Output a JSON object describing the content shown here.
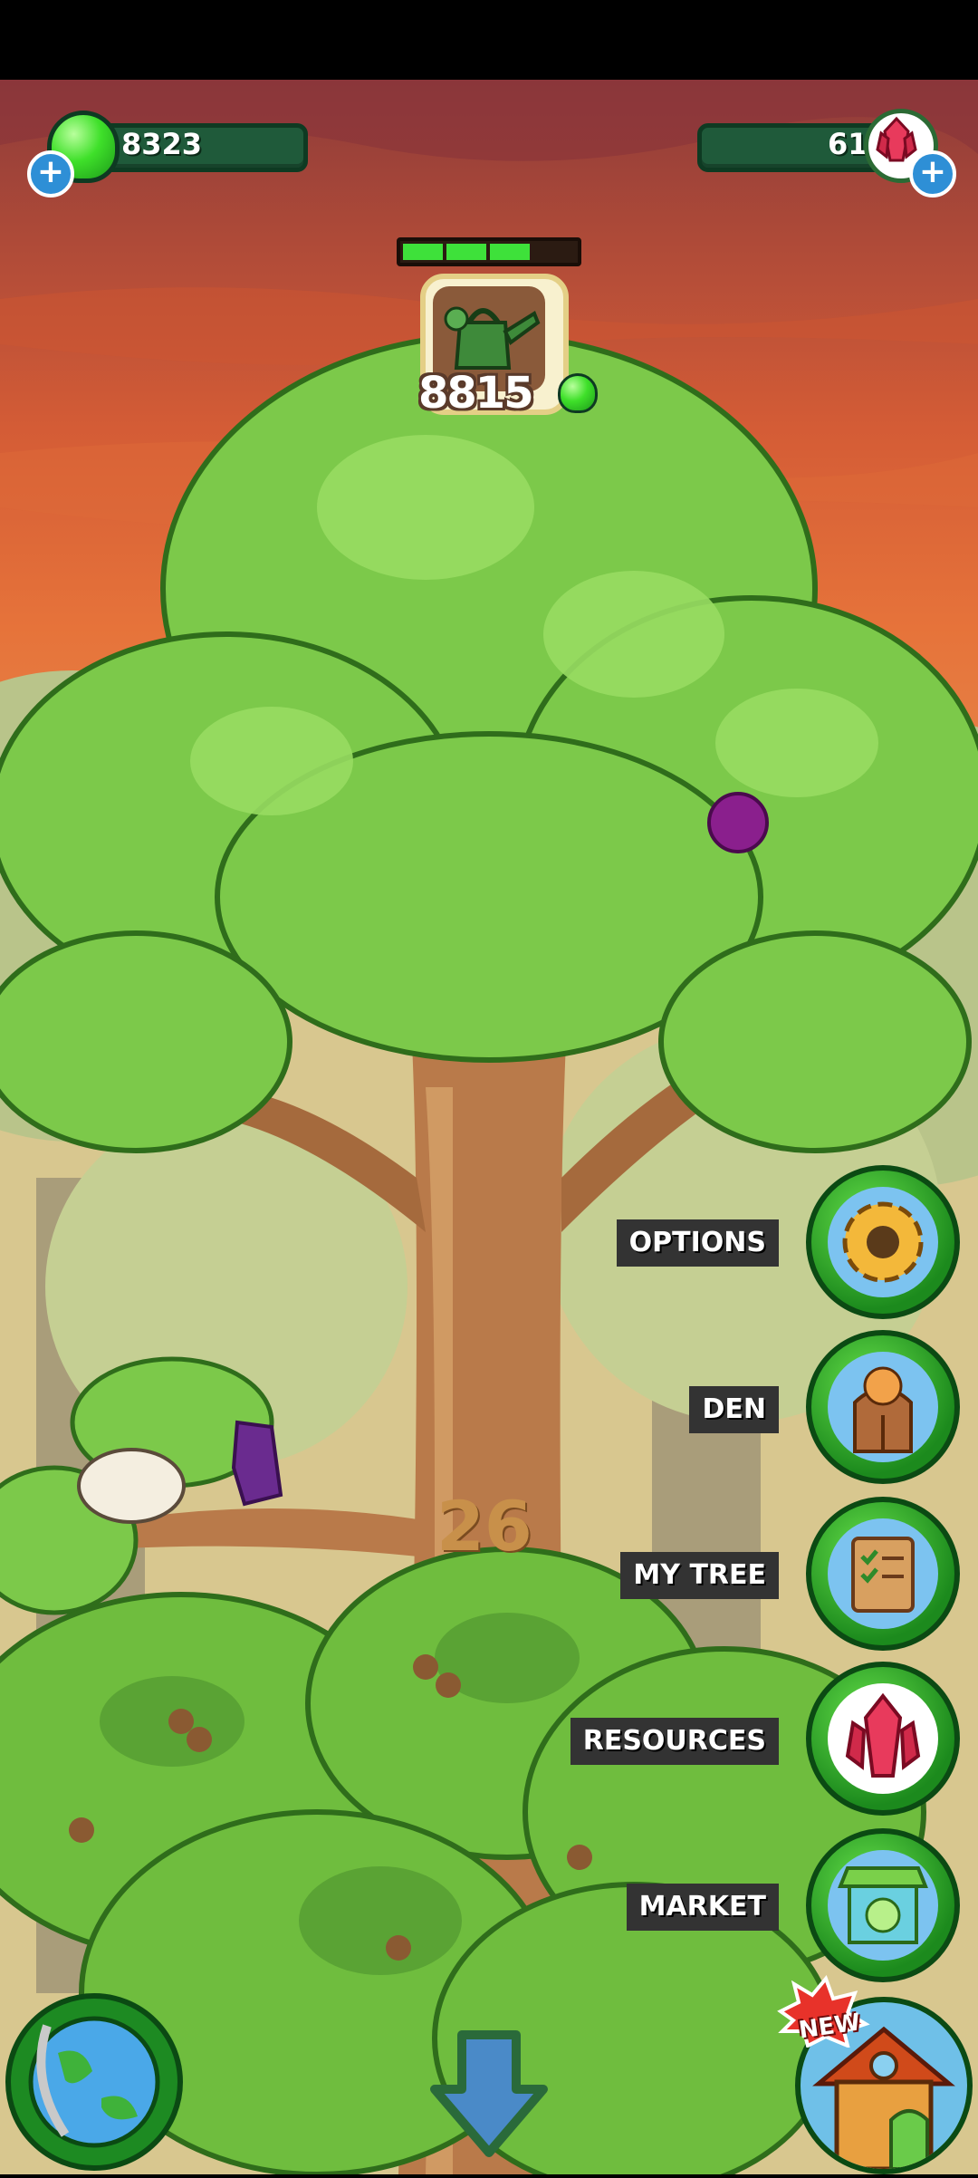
{
  "currency": {
    "green_gems": "8323",
    "red_crystals": "61"
  },
  "progress": {
    "filled_segments": 3,
    "total_segments": 4
  },
  "reward": {
    "amount": "8815"
  },
  "tree_level": "26",
  "menu": {
    "items": [
      {
        "label": "OPTIONS",
        "icon": "gear-icon"
      },
      {
        "label": "DEN",
        "icon": "cat-den-icon"
      },
      {
        "label": "MY TREE",
        "icon": "checklist-scroll-icon"
      },
      {
        "label": "RESOURCES",
        "icon": "red-crystal-icon"
      },
      {
        "label": "MARKET",
        "icon": "market-stall-icon"
      }
    ]
  },
  "bottom": {
    "new_badge": "NEW",
    "globe_icon": "globe-icon",
    "down_icon": "down-arrow-icon",
    "house_icon": "house-icon"
  },
  "colors": {
    "sky_top": "#8e3b3a",
    "sky_bottom": "#e6733a",
    "leaf": "#7cc94a",
    "trunk": "#b97a4a",
    "button_green": "#1d8a22"
  }
}
